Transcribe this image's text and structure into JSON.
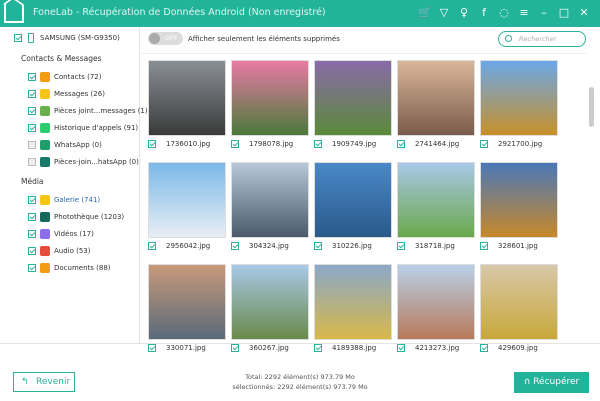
{
  "title": "FoneLab - Récupération de Données Android (Non enregistré)",
  "device": "SAMSUNG (SM-G9350)",
  "sections": {
    "contacts": "Contacts & Messages",
    "media": "Média"
  },
  "contacts_items": [
    {
      "label": "Contacts (72)",
      "checked": true,
      "color": "#f39c12"
    },
    {
      "label": "Messages (26)",
      "checked": true,
      "color": "#f5c518"
    },
    {
      "label": "Pièces joint...messages (1)",
      "checked": true,
      "color": "#6ab04c"
    },
    {
      "label": "Historique d'appels (91)",
      "checked": true,
      "color": "#2ecc71"
    },
    {
      "label": "WhatsApp (0)",
      "checked": false,
      "color": "#1e9e6a"
    },
    {
      "label": "Pièces-join...hatsApp (0)",
      "checked": false,
      "color": "#1a7a6a"
    }
  ],
  "media_items": [
    {
      "label": "Galerie (741)",
      "checked": true,
      "color": "#f5c518",
      "active": true
    },
    {
      "label": "Photothèque (1203)",
      "checked": true,
      "color": "#16685a"
    },
    {
      "label": "Vidéos (17)",
      "checked": true,
      "color": "#8e6de8"
    },
    {
      "label": "Audio (53)",
      "checked": true,
      "color": "#e74c3c"
    },
    {
      "label": "Documents (88)",
      "checked": true,
      "color": "#f39c12"
    }
  ],
  "toggle": "OFF",
  "only_deleted": "Afficher seulement les éléments supprimés",
  "search_placeholder": "Rechercher",
  "photos": [
    {
      "name": "1736010.jpg",
      "c": [
        "#8a8f96",
        "#3a3a3a"
      ]
    },
    {
      "name": "1798078.jpg",
      "c": [
        "#e87aa4",
        "#4a7a3a"
      ]
    },
    {
      "name": "1909749.jpg",
      "c": [
        "#8a6aa8",
        "#5a8a3a"
      ]
    },
    {
      "name": "2741464.jpg",
      "c": [
        "#d9b79a",
        "#7a5a4a"
      ]
    },
    {
      "name": "2921700.jpg",
      "c": [
        "#6aa8e8",
        "#c8902a"
      ]
    },
    {
      "name": "2956042.jpg",
      "c": [
        "#7ab8e8",
        "#e8eef4"
      ]
    },
    {
      "name": "304324.jpg",
      "c": [
        "#b8c8d8",
        "#4a5a6a"
      ]
    },
    {
      "name": "310226.jpg",
      "c": [
        "#4a88c8",
        "#2a5a8a"
      ]
    },
    {
      "name": "318718.jpg",
      "c": [
        "#a8c8e8",
        "#6aa84a"
      ]
    },
    {
      "name": "328601.jpg",
      "c": [
        "#4a78b8",
        "#c8882a"
      ]
    },
    {
      "name": "330071.jpg",
      "c": [
        "#c89a7a",
        "#5a6a7a"
      ]
    },
    {
      "name": "360267.jpg",
      "c": [
        "#a8c8e8",
        "#6a8a4a"
      ]
    },
    {
      "name": "4189388.jpg",
      "c": [
        "#8aa8c8",
        "#d8b84a"
      ]
    },
    {
      "name": "4213273.jpg",
      "c": [
        "#b8d0e8",
        "#b87a5a"
      ]
    },
    {
      "name": "429609.jpg",
      "c": [
        "#d8c8a8",
        "#c8a83a"
      ]
    }
  ],
  "footer": {
    "back": "Revenir",
    "total": "Total: 2292 élément(s) 973.79 Mo",
    "selected": "sélectionnés: 2292 élément(s) 973.79 Mo",
    "recover": "Récupérer"
  }
}
